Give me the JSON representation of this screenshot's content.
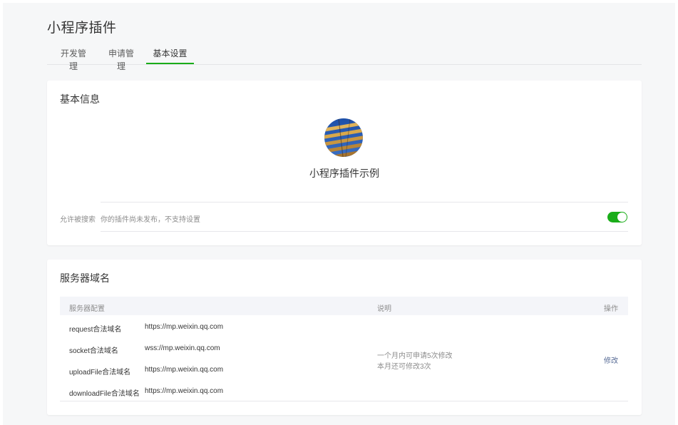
{
  "page": {
    "title": "小程序插件"
  },
  "tabs": [
    {
      "label": "开发管理",
      "active": false
    },
    {
      "label": "申请管理",
      "active": false
    },
    {
      "label": "基本设置",
      "active": true
    }
  ],
  "basic_info": {
    "section_title": "基本信息",
    "plugin_name": "小程序插件示例",
    "search_setting": {
      "label": "允许被搜索",
      "description": "你的插件尚未发布，不支持设置",
      "enabled": true
    }
  },
  "server_domains": {
    "section_title": "服务器域名",
    "columns": {
      "config": "服务器配置",
      "note": "说明",
      "action": "操作"
    },
    "rows": [
      {
        "name": "request合法域名",
        "value": "https://mp.weixin.qq.com"
      },
      {
        "name": "socket合法域名",
        "value": "wss://mp.weixin.qq.com"
      },
      {
        "name": "uploadFile合法域名",
        "value": "https://mp.weixin.qq.com"
      },
      {
        "name": "downloadFile合法域名",
        "value": "https://mp.weixin.qq.com"
      }
    ],
    "note_line1": "一个月内可申请5次修改",
    "note_line2": "本月还可修改3次",
    "action_label": "修改"
  },
  "colors": {
    "accent": "#1aad19",
    "link": "#576b95",
    "background": "#f6f7f8"
  }
}
